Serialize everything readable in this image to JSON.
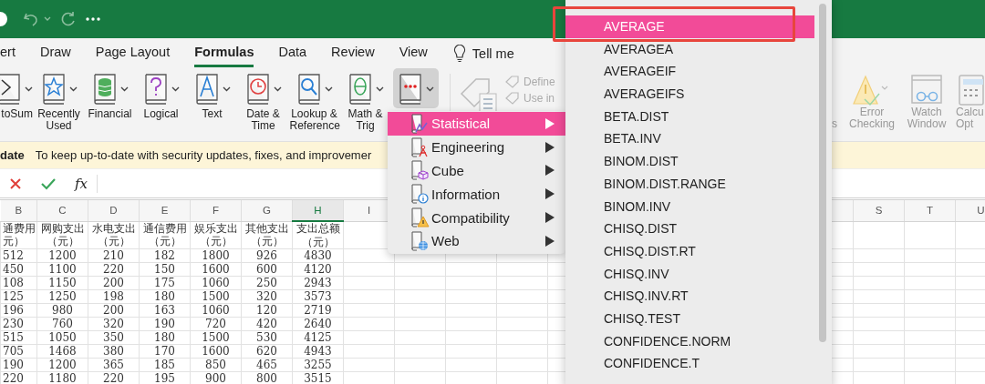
{
  "ribbon_tabs": [
    {
      "label": "ert",
      "selected": false
    },
    {
      "label": "Draw",
      "selected": false
    },
    {
      "label": "Page Layout",
      "selected": false
    },
    {
      "label": "Formulas",
      "selected": true
    },
    {
      "label": "Data",
      "selected": false
    },
    {
      "label": "Review",
      "selected": false
    },
    {
      "label": "View",
      "selected": false
    }
  ],
  "tell_me": "Tell me",
  "function_buttons": [
    {
      "label": "toSum",
      "active": false
    },
    {
      "label": "Recently Used",
      "active": false
    },
    {
      "label": "Financial",
      "active": false
    },
    {
      "label": "Logical",
      "active": false
    },
    {
      "label": "Text",
      "active": false
    },
    {
      "label": "Date & Time",
      "active": false
    },
    {
      "label": "Lookup & Reference",
      "active": false
    },
    {
      "label": "Math & Trig",
      "active": false
    },
    {
      "active": true
    }
  ],
  "defined_names": [
    {
      "label": "Define",
      "disabled": true
    },
    {
      "label": "Use in",
      "disabled": true
    }
  ],
  "audit_buttons": [
    {
      "label": "s"
    },
    {
      "label": "Error Checking"
    },
    {
      "label": "Watch Window"
    },
    {
      "label": "Calcu Opt"
    }
  ],
  "message_bar": {
    "title": "date",
    "text": "To keep up-to-date with security updates, fixes, and improvemer"
  },
  "formula_bar": {
    "function_label": "fx"
  },
  "sheet": {
    "columns": [
      {
        "label": "B",
        "selected": false
      },
      {
        "label": "C",
        "selected": false
      },
      {
        "label": "D",
        "selected": false
      },
      {
        "label": "E",
        "selected": false
      },
      {
        "label": "F",
        "selected": false
      },
      {
        "label": "G",
        "selected": false
      },
      {
        "label": "H",
        "selected": true
      },
      {
        "label": "I",
        "selected": false
      }
    ],
    "right_columns": [
      "S",
      "T",
      "U"
    ],
    "header_row": [
      {
        "title": "通费用",
        "unit": "元）"
      },
      {
        "title": "网购支出",
        "unit": "（元）"
      },
      {
        "title": "水电支出",
        "unit": "（元）"
      },
      {
        "title": "通信费用",
        "unit": "（元）"
      },
      {
        "title": "娱乐支出",
        "unit": "（元）"
      },
      {
        "title": "其他支出",
        "unit": "（元）"
      },
      {
        "title": "支出总额",
        "unit": "（元）"
      }
    ],
    "rows": [
      [
        "512",
        "1200",
        "210",
        "182",
        "1800",
        "926",
        "4830"
      ],
      [
        "450",
        "1100",
        "220",
        "150",
        "1600",
        "600",
        "4120"
      ],
      [
        "108",
        "1150",
        "200",
        "175",
        "1060",
        "250",
        "2943"
      ],
      [
        "125",
        "1250",
        "198",
        "180",
        "1500",
        "320",
        "3573"
      ],
      [
        "196",
        "980",
        "200",
        "163",
        "1060",
        "120",
        "2719"
      ],
      [
        "230",
        "760",
        "320",
        "190",
        "720",
        "420",
        "2640"
      ],
      [
        "515",
        "1050",
        "350",
        "180",
        "1500",
        "530",
        "4125"
      ],
      [
        "705",
        "1468",
        "380",
        "170",
        "1600",
        "620",
        "4943"
      ],
      [
        "190",
        "1200",
        "365",
        "185",
        "850",
        "465",
        "3255"
      ],
      [
        "220",
        "1180",
        "220",
        "195",
        "900",
        "800",
        "3515"
      ]
    ]
  },
  "category_menu": [
    {
      "label": "Statistical",
      "selected": true
    },
    {
      "label": "Engineering",
      "selected": false
    },
    {
      "label": "Cube",
      "selected": false
    },
    {
      "label": "Information",
      "selected": false
    },
    {
      "label": "Compatibility",
      "selected": false
    },
    {
      "label": "Web",
      "selected": false
    }
  ],
  "function_menu": [
    {
      "label": "AVERAGE",
      "selected": true
    },
    {
      "label": "AVERAGEA",
      "selected": false
    },
    {
      "label": "AVERAGEIF",
      "selected": false
    },
    {
      "label": "AVERAGEIFS",
      "selected": false
    },
    {
      "label": "BETA.DIST",
      "selected": false
    },
    {
      "label": "BETA.INV",
      "selected": false
    },
    {
      "label": "BINOM.DIST",
      "selected": false
    },
    {
      "label": "BINOM.DIST.RANGE",
      "selected": false
    },
    {
      "label": "BINOM.INV",
      "selected": false
    },
    {
      "label": "CHISQ.DIST",
      "selected": false
    },
    {
      "label": "CHISQ.DIST.RT",
      "selected": false
    },
    {
      "label": "CHISQ.INV",
      "selected": false
    },
    {
      "label": "CHISQ.INV.RT",
      "selected": false
    },
    {
      "label": "CHISQ.TEST",
      "selected": false
    },
    {
      "label": "CONFIDENCE.NORM",
      "selected": false
    },
    {
      "label": "CONFIDENCE.T",
      "selected": false
    }
  ]
}
